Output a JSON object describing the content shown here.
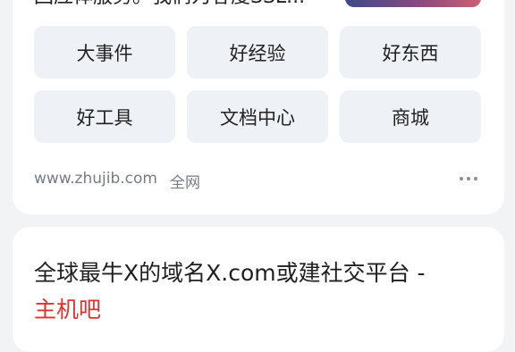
{
  "result1": {
    "snippet_text": "回应体服务。我们为客度SSL...",
    "links": [
      "大事件",
      "好经验",
      "好东西",
      "好工具",
      "文档中心",
      "商城"
    ],
    "source_domain": "www.zhujib.com",
    "source_tag": "全网"
  },
  "result2": {
    "title_line1": "全球最牛X的域名X.com或建社交平台 -",
    "title_line2": "主机吧"
  }
}
